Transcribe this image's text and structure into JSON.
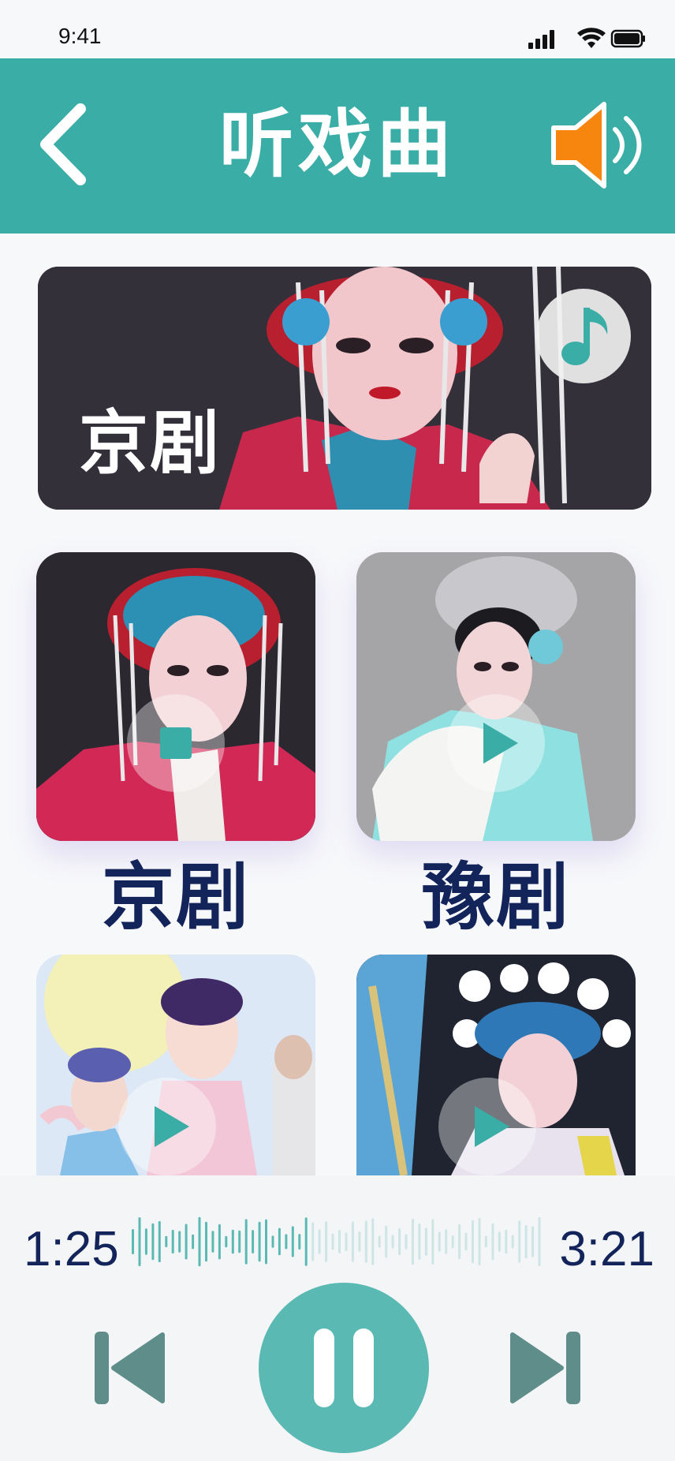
{
  "status_bar": {
    "time": "9:41"
  },
  "header": {
    "title": "听戏曲",
    "back_icon": "chevron-left-icon",
    "sound_icon": "speaker-icon"
  },
  "banner": {
    "label": "京剧",
    "badge_icon": "music-note-icon"
  },
  "cards": [
    {
      "label": "京剧",
      "state": "playing",
      "icon": "stop-icon"
    },
    {
      "label": "豫剧",
      "state": "paused",
      "icon": "play-icon"
    },
    {
      "label": "",
      "state": "paused",
      "icon": "play-icon"
    },
    {
      "label": "",
      "state": "paused",
      "icon": "play-icon"
    }
  ],
  "player": {
    "current_time": "1:25",
    "total_time": "3:21",
    "progress": 0.42,
    "prev_icon": "skip-previous-icon",
    "pause_icon": "pause-icon",
    "next_icon": "skip-next-icon"
  },
  "colors": {
    "header": "#3aada6",
    "accent": "#5bb9b3",
    "label_text": "#13245a",
    "speaker": "#f7860f"
  }
}
